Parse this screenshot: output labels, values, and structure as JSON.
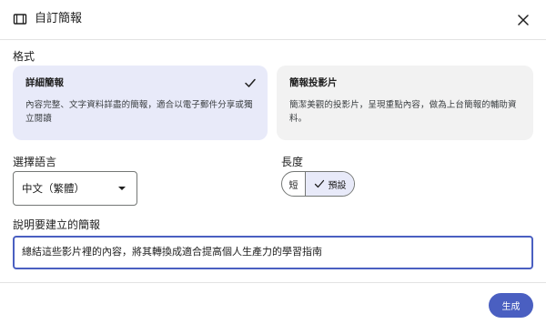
{
  "dialog": {
    "title": "自訂簡報",
    "title_icon": "slides-icon",
    "close_icon": "close-icon"
  },
  "format": {
    "label": "格式",
    "options": [
      {
        "title": "詳細簡報",
        "description": "內容完整、文字資料詳盡的簡報，適合以電子郵件分享或獨立閱讀",
        "selected": true
      },
      {
        "title": "簡報投影片",
        "description": "簡潔美觀的投影片，呈現重點內容，做為上台簡報的輔助資料。",
        "selected": false
      }
    ]
  },
  "language": {
    "label": "選擇語言",
    "selected": "中文（繁體）"
  },
  "length": {
    "label": "長度",
    "options": [
      "短",
      "預設"
    ],
    "selected": "預設"
  },
  "prompt": {
    "label": "說明要建立的簡報",
    "value": "總結這些影片裡的內容，將其轉換成適合提高個人生產力的學習指南"
  },
  "actions": {
    "generate": "生成"
  },
  "colors": {
    "accent": "#4a5fc1",
    "selected_card_bg": "#e8eaf9",
    "card_bg": "#f2f2f2"
  }
}
